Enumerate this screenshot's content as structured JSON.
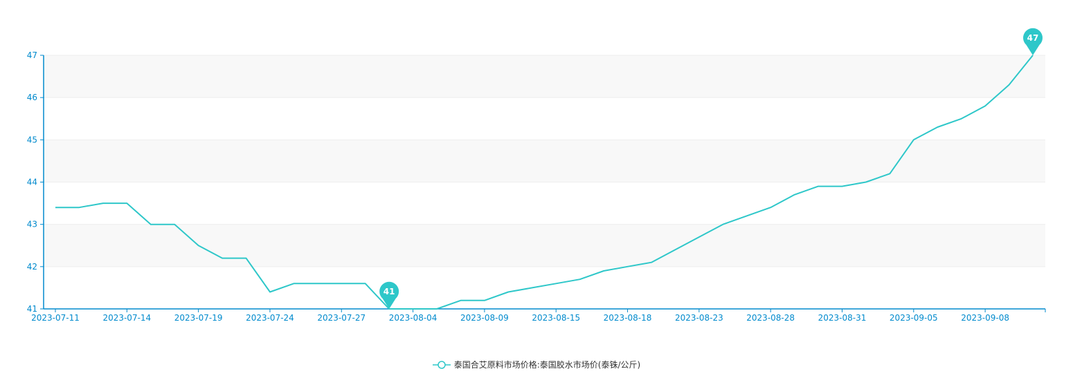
{
  "colors": {
    "series": "#2ec7c9",
    "axis": "#008acd",
    "band": "#f8f8f8",
    "grid": "#eeeeee"
  },
  "chart_data": {
    "type": "line",
    "title": "",
    "xlabel": "",
    "ylabel": "",
    "ylim": [
      41,
      47
    ],
    "yticks": [
      41,
      42,
      43,
      44,
      45,
      46,
      47
    ],
    "grid": true,
    "legend_position": "bottom-center",
    "x_tick_labels": [
      "2023-07-11",
      "2023-07-14",
      "2023-07-19",
      "2023-07-24",
      "2023-07-27",
      "2023-08-04",
      "2023-08-09",
      "2023-08-15",
      "2023-08-18",
      "2023-08-23",
      "2023-08-28",
      "2023-08-31",
      "2023-09-05",
      "2023-09-08"
    ],
    "series": [
      {
        "name": "泰国合艾原料市场价格:泰国胶水市场价(泰铢/公斤)",
        "values": [
          43.4,
          43.4,
          43.5,
          43.5,
          43.0,
          43.0,
          42.5,
          42.2,
          42.2,
          41.4,
          41.6,
          41.6,
          41.6,
          41.6,
          41.0,
          41.0,
          41.0,
          41.2,
          41.2,
          41.4,
          41.5,
          41.6,
          41.7,
          41.9,
          42.0,
          42.1,
          42.4,
          42.7,
          43.0,
          43.2,
          43.4,
          43.7,
          43.9,
          43.9,
          44.0,
          44.2,
          45.0,
          45.3,
          45.5,
          45.8,
          46.3,
          47.0
        ]
      }
    ],
    "markers": [
      {
        "label": "41",
        "index": 14,
        "value": 41
      },
      {
        "label": "47",
        "index": 41,
        "value": 47
      }
    ]
  }
}
